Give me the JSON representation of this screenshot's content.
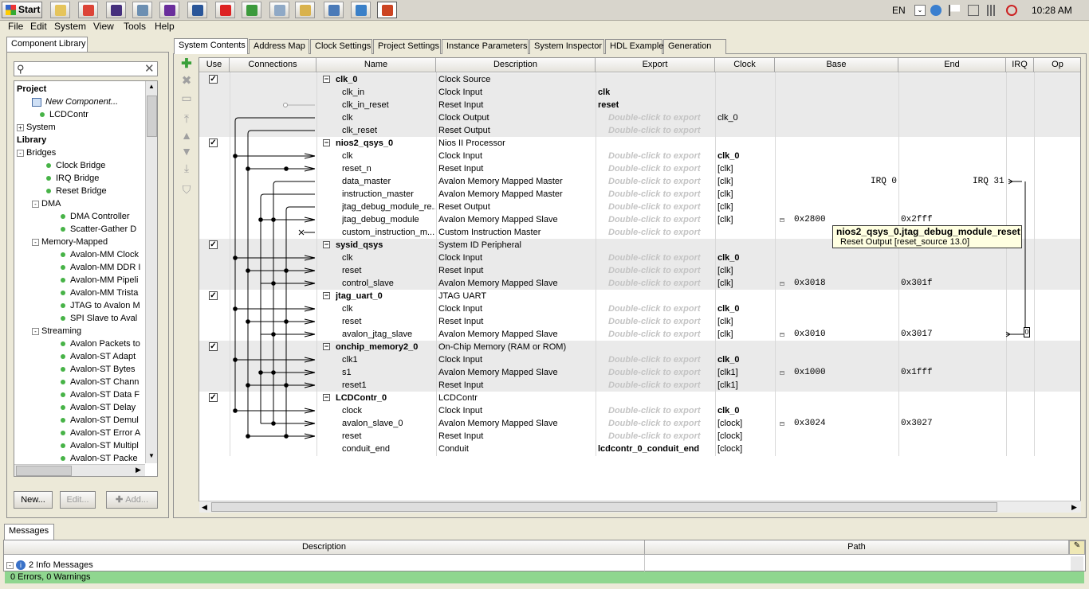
{
  "taskbar": {
    "start_label": "Start",
    "apps": [
      {
        "name": "folder-icon",
        "color": "#e5c45b"
      },
      {
        "name": "chrome-icon",
        "color": "#dc4437"
      },
      {
        "name": "eclipse-icon",
        "color": "#46307d"
      },
      {
        "name": "cube-icon",
        "color": "#6c8fb2"
      },
      {
        "name": "visual-studio-icon",
        "color": "#6a2e9c"
      },
      {
        "name": "word-icon",
        "color": "#2a5699"
      },
      {
        "name": "crosshair-icon",
        "color": "#d22"
      },
      {
        "name": "game-icon",
        "color": "#3c9a3c"
      },
      {
        "name": "calculator-icon",
        "color": "#8fa9c6"
      },
      {
        "name": "explorer-icon",
        "color": "#d9b24c"
      },
      {
        "name": "box-icon",
        "color": "#4a7ab8"
      },
      {
        "name": "network-icon",
        "color": "#3a80c8"
      },
      {
        "name": "qsys-icon",
        "color": "#c42"
      }
    ],
    "language": "EN",
    "clock": "10:28 AM"
  },
  "menu": [
    "File",
    "Edit",
    "System",
    "View",
    "Tools",
    "Help"
  ],
  "left_panel": {
    "tab": "Component Library",
    "buttons": {
      "new": "New...",
      "edit": "Edit...",
      "add": "Add..."
    },
    "tree": [
      {
        "label": "Project",
        "level": 0,
        "bold": true
      },
      {
        "label": "New Component...",
        "level": 1,
        "italic": true,
        "icon": "component-icon"
      },
      {
        "label": "LCDContr",
        "level": 1,
        "dot": true
      },
      {
        "label": "System",
        "level": 0,
        "expander": "+"
      },
      {
        "label": "Library",
        "level": 0,
        "bold": true
      },
      {
        "label": "Bridges",
        "level": 0,
        "expander": "-"
      },
      {
        "label": "Clock Bridge",
        "level": 2,
        "dot": true
      },
      {
        "label": "IRQ Bridge",
        "level": 2,
        "dot": true
      },
      {
        "label": "Reset Bridge",
        "level": 2,
        "dot": true
      },
      {
        "label": "DMA",
        "level": 1,
        "expander": "-"
      },
      {
        "label": "DMA Controller",
        "level": 3,
        "dot": true
      },
      {
        "label": "Scatter-Gather D",
        "level": 3,
        "dot": true
      },
      {
        "label": "Memory-Mapped",
        "level": 1,
        "expander": "-"
      },
      {
        "label": "Avalon-MM Clock",
        "level": 3,
        "dot": true
      },
      {
        "label": "Avalon-MM DDR I",
        "level": 3,
        "dot": true
      },
      {
        "label": "Avalon-MM Pipeli",
        "level": 3,
        "dot": true
      },
      {
        "label": "Avalon-MM Trista",
        "level": 3,
        "dot": true
      },
      {
        "label": "JTAG to Avalon M",
        "level": 3,
        "dot": true
      },
      {
        "label": "SPI Slave to Aval",
        "level": 3,
        "dot": true
      },
      {
        "label": "Streaming",
        "level": 1,
        "expander": "-"
      },
      {
        "label": "Avalon Packets to",
        "level": 3,
        "dot": true
      },
      {
        "label": "Avalon-ST Adapt",
        "level": 3,
        "dot": true
      },
      {
        "label": "Avalon-ST Bytes",
        "level": 3,
        "dot": true
      },
      {
        "label": "Avalon-ST Chann",
        "level": 3,
        "dot": true
      },
      {
        "label": "Avalon-ST Data F",
        "level": 3,
        "dot": true
      },
      {
        "label": "Avalon-ST Delay",
        "level": 3,
        "dot": true
      },
      {
        "label": "Avalon-ST Demul",
        "level": 3,
        "dot": true
      },
      {
        "label": "Avalon-ST Error A",
        "level": 3,
        "dot": true
      },
      {
        "label": "Avalon-ST Multipl",
        "level": 3,
        "dot": true
      },
      {
        "label": "Avalon-ST Packe",
        "level": 3,
        "dot": true
      }
    ]
  },
  "tabs": [
    "System Contents",
    "Address Map",
    "Clock Settings",
    "Project Settings",
    "Instance Parameters",
    "System Inspector",
    "HDL Example",
    "Generation"
  ],
  "columns": [
    "Use",
    "Connections",
    "Name",
    "Description",
    "Export",
    "Clock",
    "Base",
    "End",
    "IRQ",
    "Op"
  ],
  "rows": [
    {
      "type": "component",
      "name": "clk_0",
      "desc": "Clock Source",
      "export": "",
      "clock": "",
      "use": true,
      "shaded": true
    },
    {
      "name": "clk_in",
      "desc": "Clock Input",
      "export": "clk",
      "export_bold": true,
      "clock": "",
      "shaded": true
    },
    {
      "name": "clk_in_reset",
      "desc": "Reset Input",
      "export": "reset",
      "export_bold": true,
      "clock": "",
      "shaded": true
    },
    {
      "name": "clk",
      "desc": "Clock Output",
      "export": "Double-click to export",
      "ghost": true,
      "clock": "clk_0",
      "shaded": true
    },
    {
      "name": "clk_reset",
      "desc": "Reset Output",
      "export": "Double-click to export",
      "ghost": true,
      "clock": "",
      "shaded": true
    },
    {
      "type": "component",
      "name": "nios2_qsys_0",
      "desc": "Nios II Processor",
      "export": "",
      "clock": "",
      "use": true
    },
    {
      "name": "clk",
      "desc": "Clock Input",
      "export": "Double-click to export",
      "ghost": true,
      "clock": "clk_0",
      "clock_bold": true
    },
    {
      "name": "reset_n",
      "desc": "Reset Input",
      "export": "Double-click to export",
      "ghost": true,
      "clock": "[clk]"
    },
    {
      "name": "data_master",
      "desc": "Avalon Memory Mapped Master",
      "export": "Double-click to export",
      "ghost": true,
      "clock": "[clk]",
      "irq_left": "IRQ 0",
      "irq_right": "IRQ 31"
    },
    {
      "name": "instruction_master",
      "desc": "Avalon Memory Mapped Master",
      "export": "Double-click to export",
      "ghost": true,
      "clock": "[clk]"
    },
    {
      "name": "jtag_debug_module_re...",
      "desc": "Reset Output",
      "export": "Double-click to export",
      "ghost": true,
      "clock": "[clk]"
    },
    {
      "name": "jtag_debug_module",
      "desc": "Avalon Memory Mapped Slave",
      "export": "Double-click to export",
      "ghost": true,
      "clock": "[clk]",
      "base": "0x2800",
      "end": "0x2fff"
    },
    {
      "name": "custom_instruction_m...",
      "desc": "Custom Instruction Master",
      "export": "Double-click to export",
      "ghost": true,
      "clock": ""
    },
    {
      "type": "component",
      "name": "sysid_qsys",
      "desc": "System ID Peripheral",
      "export": "",
      "clock": "",
      "use": true,
      "shaded": true
    },
    {
      "name": "clk",
      "desc": "Clock Input",
      "export": "Double-click to export",
      "ghost": true,
      "clock": "clk_0",
      "clock_bold": true,
      "shaded": true
    },
    {
      "name": "reset",
      "desc": "Reset Input",
      "export": "Double-click to export",
      "ghost": true,
      "clock": "[clk]",
      "shaded": true
    },
    {
      "name": "control_slave",
      "desc": "Avalon Memory Mapped Slave",
      "export": "Double-click to export",
      "ghost": true,
      "clock": "[clk]",
      "base": "0x3018",
      "end": "0x301f",
      "shaded": true
    },
    {
      "type": "component",
      "name": "jtag_uart_0",
      "desc": "JTAG UART",
      "export": "",
      "clock": "",
      "use": true
    },
    {
      "name": "clk",
      "desc": "Clock Input",
      "export": "Double-click to export",
      "ghost": true,
      "clock": "clk_0",
      "clock_bold": true
    },
    {
      "name": "reset",
      "desc": "Reset Input",
      "export": "Double-click to export",
      "ghost": true,
      "clock": "[clk]"
    },
    {
      "name": "avalon_jtag_slave",
      "desc": "Avalon Memory Mapped Slave",
      "export": "Double-click to export",
      "ghost": true,
      "clock": "[clk]",
      "base": "0x3010",
      "end": "0x3017",
      "irq_num": "0"
    },
    {
      "type": "component",
      "name": "onchip_memory2_0",
      "desc": "On-Chip Memory (RAM or ROM)",
      "export": "",
      "clock": "",
      "use": true,
      "shaded": true
    },
    {
      "name": "clk1",
      "desc": "Clock Input",
      "export": "Double-click to export",
      "ghost": true,
      "clock": "clk_0",
      "clock_bold": true,
      "shaded": true
    },
    {
      "name": "s1",
      "desc": "Avalon Memory Mapped Slave",
      "export": "Double-click to export",
      "ghost": true,
      "clock": "[clk1]",
      "base": "0x1000",
      "end": "0x1fff",
      "shaded": true
    },
    {
      "name": "reset1",
      "desc": "Reset Input",
      "export": "Double-click to export",
      "ghost": true,
      "clock": "[clk1]",
      "shaded": true
    },
    {
      "type": "component",
      "name": "LCDContr_0",
      "desc": "LCDContr",
      "export": "",
      "clock": "",
      "use": true
    },
    {
      "name": "clock",
      "desc": "Clock Input",
      "export": "Double-click to export",
      "ghost": true,
      "clock": "clk_0",
      "clock_bold": true
    },
    {
      "name": "avalon_slave_0",
      "desc": "Avalon Memory Mapped Slave",
      "export": "Double-click to export",
      "ghost": true,
      "clock": "[clock]",
      "base": "0x3024",
      "end": "0x3027"
    },
    {
      "name": "reset",
      "desc": "Reset Input",
      "export": "Double-click to export",
      "ghost": true,
      "clock": "[clock]"
    },
    {
      "name": "conduit_end",
      "desc": "Conduit",
      "export": "lcdcontr_0_conduit_end",
      "export_bold": true,
      "clock": "[clock]"
    }
  ],
  "tooltip": {
    "title": "nios2_qsys_0.jtag_debug_module_reset",
    "body": "Reset Output [reset_source 13.0]"
  },
  "messages": {
    "tab": "Messages",
    "col_description": "Description",
    "col_path": "Path",
    "info_row": "2 Info Messages",
    "status": "0 Errors, 0 Warnings"
  }
}
